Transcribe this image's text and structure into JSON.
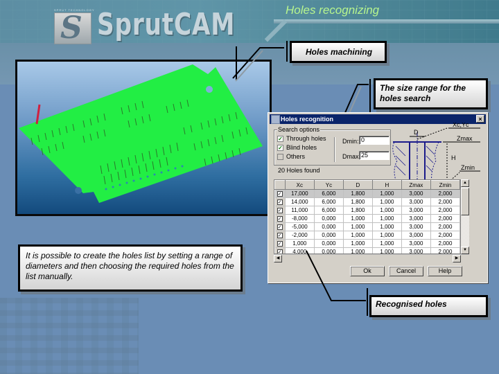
{
  "brand": {
    "logo_text": "SprutCAM",
    "logo_tagline": "SPRUT TECHNOLOGY",
    "logo_glyph": "S"
  },
  "slide": {
    "title": "Holes recognizing"
  },
  "callouts": {
    "holes_machining": "Holes machining",
    "size_range": "The size range for the holes search",
    "description": "It is possible to create the holes list by setting a range of diameters and then choosing the required holes from the list manually.",
    "recognised": "Recognised holes"
  },
  "dialog": {
    "title": "Holes recognition",
    "close_glyph": "×",
    "search_group_label": "Search options",
    "options": [
      {
        "label": "Through holes",
        "checked": true,
        "check_glyph": "✓"
      },
      {
        "label": "Blind holes",
        "checked": true,
        "check_glyph": "✓"
      },
      {
        "label": "Others",
        "checked": false,
        "check_glyph": ""
      }
    ],
    "dmin_label": "Dmin:",
    "dmin_value": "0",
    "dmax_label": "Dmax:",
    "dmax_value": "25",
    "found_text": "20 Holes found",
    "diagram_labels": {
      "d": "D",
      "center": "Xc,Yc",
      "zmax": "Zmax",
      "h": "H",
      "zmin": "Zmin"
    },
    "table": {
      "columns": [
        "",
        "Xc",
        "Yc",
        "D",
        "H",
        "Zmax",
        "Zmin"
      ],
      "rows": [
        {
          "checked": true,
          "xc": "17,000",
          "yc": "6,000",
          "d": "1,800",
          "h": "1,000",
          "zmax": "3,000",
          "zmin": "2,000",
          "selected": true
        },
        {
          "checked": true,
          "xc": "14,000",
          "yc": "6,000",
          "d": "1,800",
          "h": "1,000",
          "zmax": "3,000",
          "zmin": "2,000"
        },
        {
          "checked": true,
          "xc": "11,000",
          "yc": "6,000",
          "d": "1,800",
          "h": "1,000",
          "zmax": "3,000",
          "zmin": "2,000"
        },
        {
          "checked": true,
          "xc": "-8,000",
          "yc": "0,000",
          "d": "1,000",
          "h": "1,000",
          "zmax": "3,000",
          "zmin": "2,000"
        },
        {
          "checked": true,
          "xc": "-5,000",
          "yc": "0,000",
          "d": "1,000",
          "h": "1,000",
          "zmax": "3,000",
          "zmin": "2,000"
        },
        {
          "checked": true,
          "xc": "-2,000",
          "yc": "0,000",
          "d": "1,000",
          "h": "1,000",
          "zmax": "3,000",
          "zmin": "2,000"
        },
        {
          "checked": true,
          "xc": "1,000",
          "yc": "0,000",
          "d": "1,000",
          "h": "1,000",
          "zmax": "3,000",
          "zmin": "2,000"
        },
        {
          "checked": true,
          "xc": "4,000",
          "yc": "0,000",
          "d": "1,000",
          "h": "1,000",
          "zmax": "3,000",
          "zmin": "2,000"
        }
      ]
    },
    "scroll_up_glyph": "▲",
    "scroll_down_glyph": "▼",
    "scroll_left_glyph": "◀",
    "scroll_right_glyph": "▶",
    "ok_label": "Ok",
    "cancel_label": "Cancel",
    "help_label": "Help"
  },
  "viewport": {
    "board_color": "#22ee44",
    "background_top": "#a9c9e8",
    "background_bottom": "#134a7d"
  }
}
